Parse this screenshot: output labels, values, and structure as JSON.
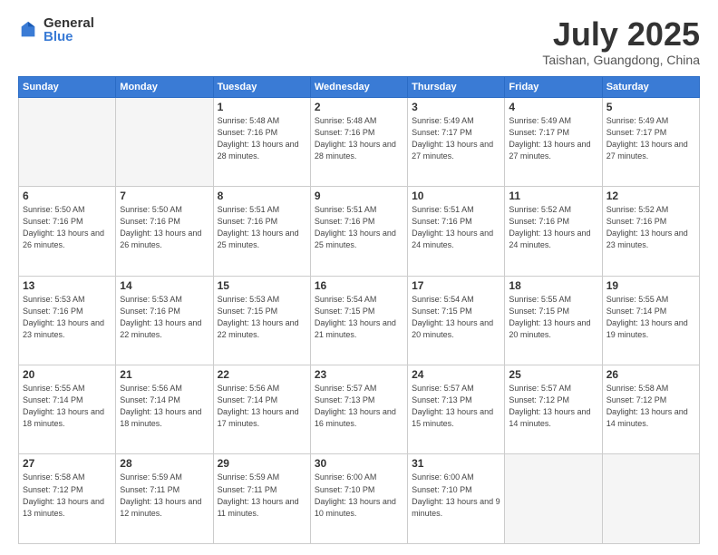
{
  "header": {
    "logo_general": "General",
    "logo_blue": "Blue",
    "month_title": "July 2025",
    "location": "Taishan, Guangdong, China"
  },
  "weekdays": [
    "Sunday",
    "Monday",
    "Tuesday",
    "Wednesday",
    "Thursday",
    "Friday",
    "Saturday"
  ],
  "weeks": [
    [
      {
        "day": "",
        "empty": true
      },
      {
        "day": "",
        "empty": true
      },
      {
        "day": "1",
        "sunrise": "Sunrise: 5:48 AM",
        "sunset": "Sunset: 7:16 PM",
        "daylight": "Daylight: 13 hours and 28 minutes."
      },
      {
        "day": "2",
        "sunrise": "Sunrise: 5:48 AM",
        "sunset": "Sunset: 7:16 PM",
        "daylight": "Daylight: 13 hours and 28 minutes."
      },
      {
        "day": "3",
        "sunrise": "Sunrise: 5:49 AM",
        "sunset": "Sunset: 7:17 PM",
        "daylight": "Daylight: 13 hours and 27 minutes."
      },
      {
        "day": "4",
        "sunrise": "Sunrise: 5:49 AM",
        "sunset": "Sunset: 7:17 PM",
        "daylight": "Daylight: 13 hours and 27 minutes."
      },
      {
        "day": "5",
        "sunrise": "Sunrise: 5:49 AM",
        "sunset": "Sunset: 7:17 PM",
        "daylight": "Daylight: 13 hours and 27 minutes."
      }
    ],
    [
      {
        "day": "6",
        "sunrise": "Sunrise: 5:50 AM",
        "sunset": "Sunset: 7:16 PM",
        "daylight": "Daylight: 13 hours and 26 minutes."
      },
      {
        "day": "7",
        "sunrise": "Sunrise: 5:50 AM",
        "sunset": "Sunset: 7:16 PM",
        "daylight": "Daylight: 13 hours and 26 minutes."
      },
      {
        "day": "8",
        "sunrise": "Sunrise: 5:51 AM",
        "sunset": "Sunset: 7:16 PM",
        "daylight": "Daylight: 13 hours and 25 minutes."
      },
      {
        "day": "9",
        "sunrise": "Sunrise: 5:51 AM",
        "sunset": "Sunset: 7:16 PM",
        "daylight": "Daylight: 13 hours and 25 minutes."
      },
      {
        "day": "10",
        "sunrise": "Sunrise: 5:51 AM",
        "sunset": "Sunset: 7:16 PM",
        "daylight": "Daylight: 13 hours and 24 minutes."
      },
      {
        "day": "11",
        "sunrise": "Sunrise: 5:52 AM",
        "sunset": "Sunset: 7:16 PM",
        "daylight": "Daylight: 13 hours and 24 minutes."
      },
      {
        "day": "12",
        "sunrise": "Sunrise: 5:52 AM",
        "sunset": "Sunset: 7:16 PM",
        "daylight": "Daylight: 13 hours and 23 minutes."
      }
    ],
    [
      {
        "day": "13",
        "sunrise": "Sunrise: 5:53 AM",
        "sunset": "Sunset: 7:16 PM",
        "daylight": "Daylight: 13 hours and 23 minutes."
      },
      {
        "day": "14",
        "sunrise": "Sunrise: 5:53 AM",
        "sunset": "Sunset: 7:16 PM",
        "daylight": "Daylight: 13 hours and 22 minutes."
      },
      {
        "day": "15",
        "sunrise": "Sunrise: 5:53 AM",
        "sunset": "Sunset: 7:15 PM",
        "daylight": "Daylight: 13 hours and 22 minutes."
      },
      {
        "day": "16",
        "sunrise": "Sunrise: 5:54 AM",
        "sunset": "Sunset: 7:15 PM",
        "daylight": "Daylight: 13 hours and 21 minutes."
      },
      {
        "day": "17",
        "sunrise": "Sunrise: 5:54 AM",
        "sunset": "Sunset: 7:15 PM",
        "daylight": "Daylight: 13 hours and 20 minutes."
      },
      {
        "day": "18",
        "sunrise": "Sunrise: 5:55 AM",
        "sunset": "Sunset: 7:15 PM",
        "daylight": "Daylight: 13 hours and 20 minutes."
      },
      {
        "day": "19",
        "sunrise": "Sunrise: 5:55 AM",
        "sunset": "Sunset: 7:14 PM",
        "daylight": "Daylight: 13 hours and 19 minutes."
      }
    ],
    [
      {
        "day": "20",
        "sunrise": "Sunrise: 5:55 AM",
        "sunset": "Sunset: 7:14 PM",
        "daylight": "Daylight: 13 hours and 18 minutes."
      },
      {
        "day": "21",
        "sunrise": "Sunrise: 5:56 AM",
        "sunset": "Sunset: 7:14 PM",
        "daylight": "Daylight: 13 hours and 18 minutes."
      },
      {
        "day": "22",
        "sunrise": "Sunrise: 5:56 AM",
        "sunset": "Sunset: 7:14 PM",
        "daylight": "Daylight: 13 hours and 17 minutes."
      },
      {
        "day": "23",
        "sunrise": "Sunrise: 5:57 AM",
        "sunset": "Sunset: 7:13 PM",
        "daylight": "Daylight: 13 hours and 16 minutes."
      },
      {
        "day": "24",
        "sunrise": "Sunrise: 5:57 AM",
        "sunset": "Sunset: 7:13 PM",
        "daylight": "Daylight: 13 hours and 15 minutes."
      },
      {
        "day": "25",
        "sunrise": "Sunrise: 5:57 AM",
        "sunset": "Sunset: 7:12 PM",
        "daylight": "Daylight: 13 hours and 14 minutes."
      },
      {
        "day": "26",
        "sunrise": "Sunrise: 5:58 AM",
        "sunset": "Sunset: 7:12 PM",
        "daylight": "Daylight: 13 hours and 14 minutes."
      }
    ],
    [
      {
        "day": "27",
        "sunrise": "Sunrise: 5:58 AM",
        "sunset": "Sunset: 7:12 PM",
        "daylight": "Daylight: 13 hours and 13 minutes."
      },
      {
        "day": "28",
        "sunrise": "Sunrise: 5:59 AM",
        "sunset": "Sunset: 7:11 PM",
        "daylight": "Daylight: 13 hours and 12 minutes."
      },
      {
        "day": "29",
        "sunrise": "Sunrise: 5:59 AM",
        "sunset": "Sunset: 7:11 PM",
        "daylight": "Daylight: 13 hours and 11 minutes."
      },
      {
        "day": "30",
        "sunrise": "Sunrise: 6:00 AM",
        "sunset": "Sunset: 7:10 PM",
        "daylight": "Daylight: 13 hours and 10 minutes."
      },
      {
        "day": "31",
        "sunrise": "Sunrise: 6:00 AM",
        "sunset": "Sunset: 7:10 PM",
        "daylight": "Daylight: 13 hours and 9 minutes."
      },
      {
        "day": "",
        "empty": true
      },
      {
        "day": "",
        "empty": true
      }
    ]
  ]
}
